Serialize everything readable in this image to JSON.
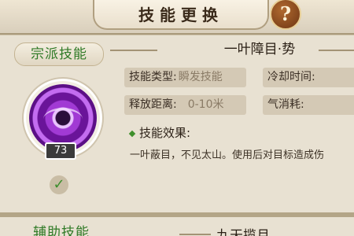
{
  "header": {
    "title": "技能更换",
    "help_label": "?"
  },
  "sections": [
    {
      "category": "宗派技能",
      "skill": {
        "name": "一叶障目·势",
        "level": "73",
        "type_label": "技能类型:",
        "type_value": "瞬发技能",
        "cooldown_label": "冷却时间:",
        "range_label": "释放距离:",
        "range_value": "0-10米",
        "qi_label": "气消耗:",
        "effect_title": "技能效果:",
        "effect_text": "一叶蔽目，不见太山。使用后对目标造成伤"
      }
    },
    {
      "category": "辅助技能",
      "skill": {
        "name": "九天揽月"
      }
    }
  ],
  "colors": {
    "accent_green": "#2f7a26",
    "panel": "#e8e1d2",
    "purple_icon": "#a13ad4"
  },
  "icons": {
    "help": "question-icon",
    "equipped": "check-icon"
  }
}
